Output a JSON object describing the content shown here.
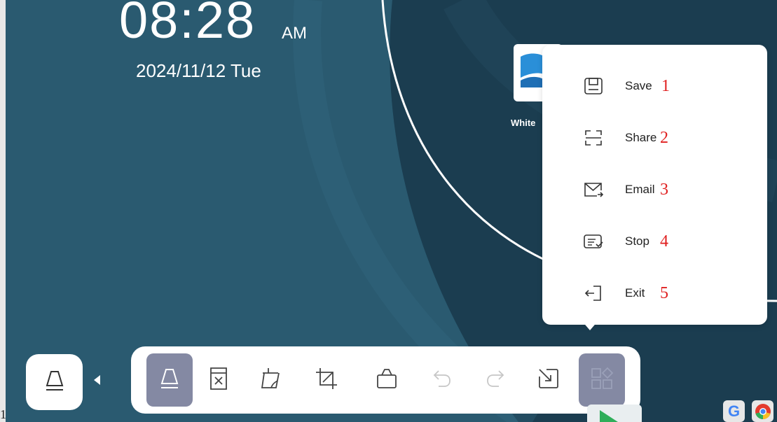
{
  "clock": {
    "time": "08:28",
    "ampm": "AM",
    "date": "2024/11/12 Tue"
  },
  "desktop_app": {
    "label": "White"
  },
  "menu": {
    "items": [
      {
        "label": "Save",
        "number": "1",
        "icon": "save-icon"
      },
      {
        "label": "Share",
        "number": "2",
        "icon": "share-icon"
      },
      {
        "label": "Email",
        "number": "3",
        "icon": "email-icon"
      },
      {
        "label": "Stop",
        "number": "4",
        "icon": "stop-icon"
      },
      {
        "label": "Exit",
        "number": "5",
        "icon": "exit-icon"
      }
    ]
  },
  "toolbar": {
    "buttons": [
      "pen-icon",
      "clear-icon",
      "eraser-icon",
      "crop-icon",
      "shape-icon",
      "undo-icon",
      "redo-icon",
      "export-icon",
      "more-apps-icon"
    ]
  },
  "corner_label": "1",
  "colors": {
    "accent": "#8489a3",
    "annotation": "#e02020",
    "background": "#1e4a5e"
  }
}
